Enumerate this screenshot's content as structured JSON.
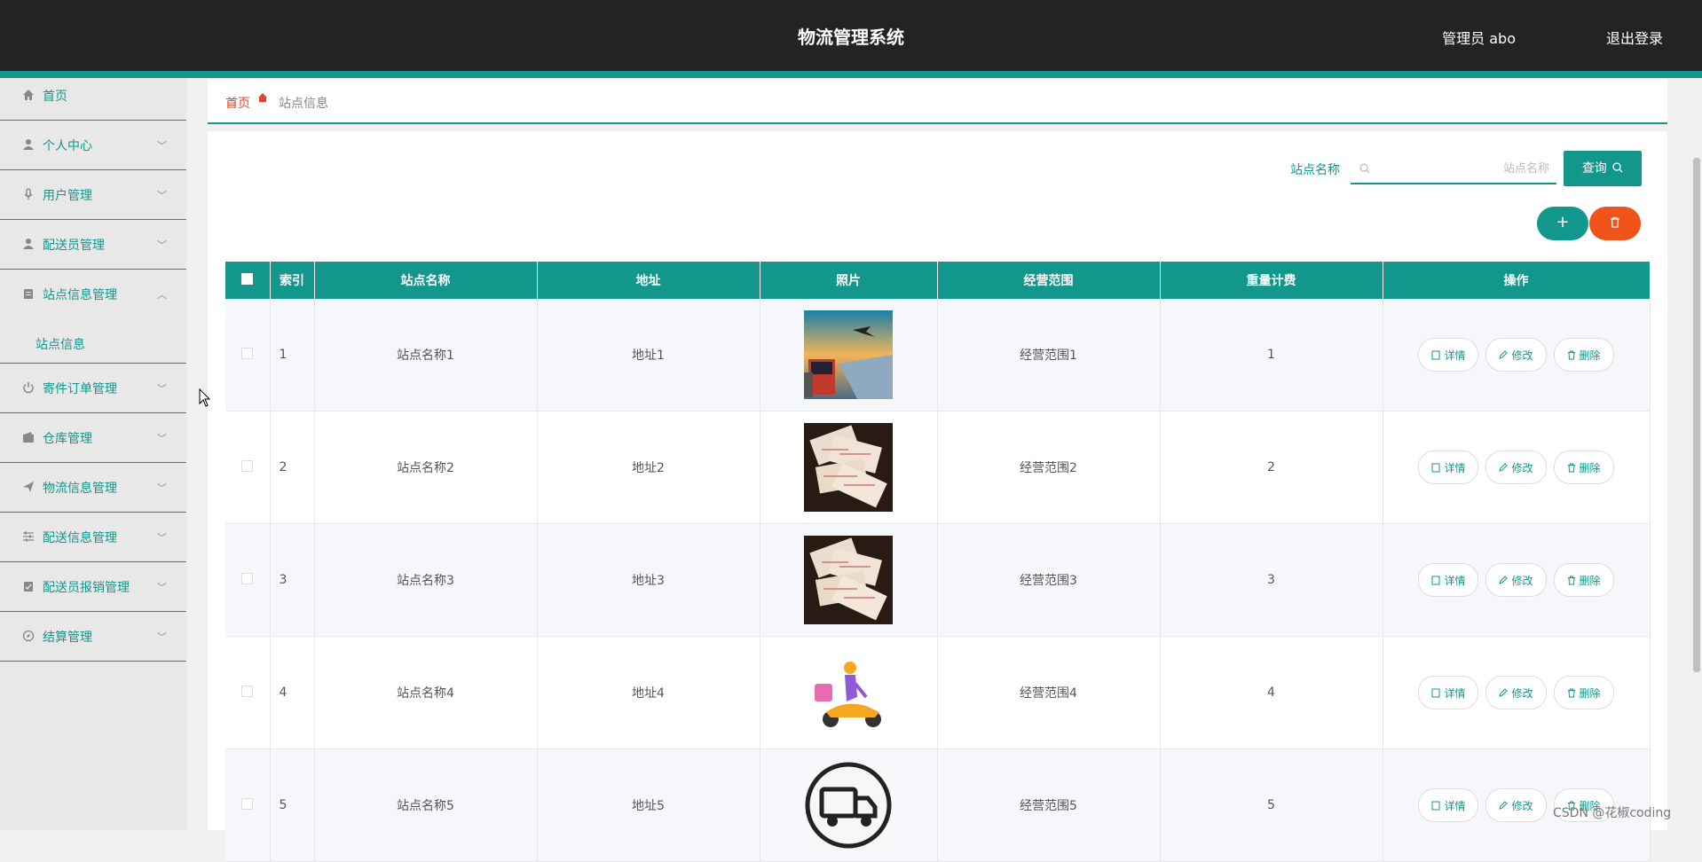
{
  "header": {
    "title": "物流管理系统",
    "user": "管理员 abo",
    "logout": "退出登录"
  },
  "sidebar": {
    "items": [
      {
        "label": "首页",
        "icon": "home-icon"
      },
      {
        "label": "个人中心",
        "icon": "user-icon"
      },
      {
        "label": "用户管理",
        "icon": "mic-icon"
      },
      {
        "label": "配送员管理",
        "icon": "user-icon"
      },
      {
        "label": "站点信息管理",
        "icon": "clipboard-icon",
        "open": true,
        "sub": "站点信息"
      },
      {
        "label": "寄件订单管理",
        "icon": "power-icon"
      },
      {
        "label": "仓库管理",
        "icon": "wallet-icon"
      },
      {
        "label": "物流信息管理",
        "icon": "send-icon"
      },
      {
        "label": "配送信息管理",
        "icon": "sliders-icon"
      },
      {
        "label": "配送员报销管理",
        "icon": "clipboard-check-icon"
      },
      {
        "label": "结算管理",
        "icon": "compass-icon"
      }
    ]
  },
  "breadcrumb": {
    "home": "首页",
    "current": "站点信息"
  },
  "search": {
    "label": "站点名称",
    "placeholder": "站点名称",
    "button": "查询"
  },
  "table": {
    "headers": [
      "索引",
      "站点名称",
      "地址",
      "照片",
      "经营范围",
      "重量计费",
      "操作"
    ],
    "rows": [
      {
        "index": "1",
        "name": "站点名称1",
        "address": "地址1",
        "photo": "truck-plane-photo",
        "scope": "经营范围1",
        "fee": "1"
      },
      {
        "index": "2",
        "name": "站点名称2",
        "address": "地址2",
        "photo": "receipts-photo",
        "scope": "经营范围2",
        "fee": "2"
      },
      {
        "index": "3",
        "name": "站点名称3",
        "address": "地址3",
        "photo": "receipts-photo",
        "scope": "经营范围3",
        "fee": "3"
      },
      {
        "index": "4",
        "name": "站点名称4",
        "address": "地址4",
        "photo": "delivery-scooter-photo",
        "scope": "经营范围4",
        "fee": "4"
      },
      {
        "index": "5",
        "name": "站点名称5",
        "address": "地址5",
        "photo": "truck-icon-photo",
        "scope": "经营范围5",
        "fee": "5"
      }
    ],
    "actions": {
      "detail": "详情",
      "edit": "修改",
      "delete": "删除"
    }
  },
  "watermark": "CSDN @花椒coding",
  "colors": {
    "accent": "#13968c",
    "danger": "#f0541b",
    "header": "#232323"
  }
}
